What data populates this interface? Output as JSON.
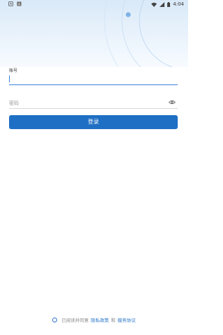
{
  "status_bar": {
    "time": "4:04",
    "left_icons": [
      "app-notification-icon",
      "a-badge-icon"
    ],
    "right_icons": [
      "wifi-icon",
      "signal-icon",
      "battery-icon"
    ]
  },
  "form": {
    "account_label": "账号",
    "account_value": "",
    "password_placeholder": "密码",
    "login_button": "登录"
  },
  "agreement": {
    "prefix": "已阅读并同意",
    "privacy_link": "隐私政策",
    "conjunction": "和",
    "service_link": "服务协议",
    "checked": false
  },
  "colors": {
    "accent": "#1f6fc4",
    "link": "#2c77c9",
    "header_gradient_top": "#d9e9f8"
  }
}
